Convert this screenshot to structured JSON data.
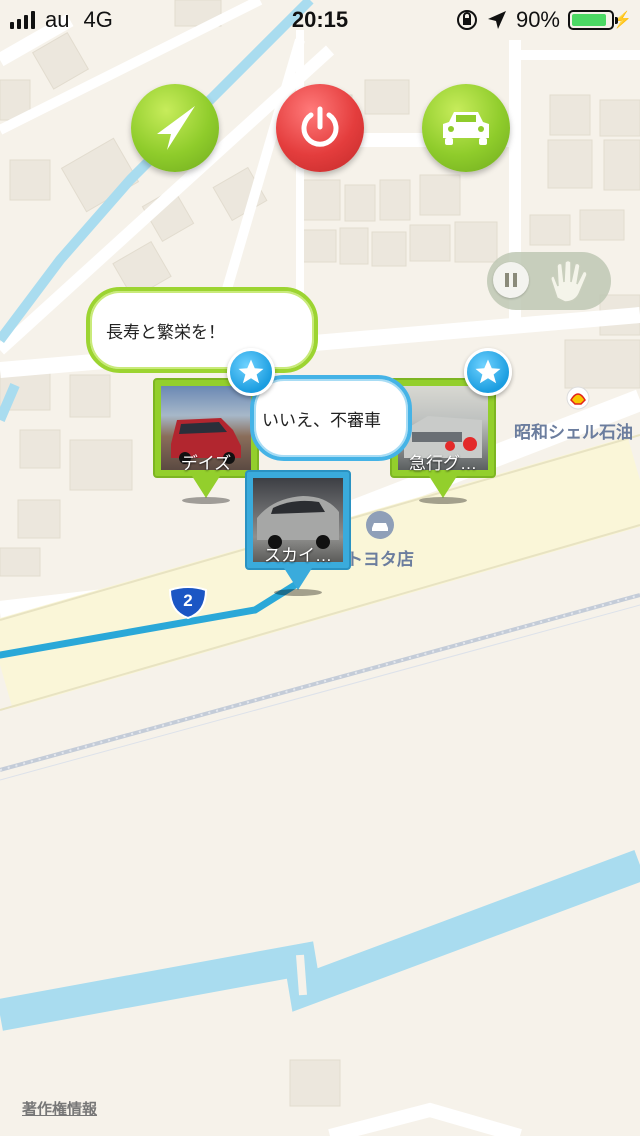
{
  "status_bar": {
    "carrier": "au",
    "network": "4G",
    "time": "20:15",
    "battery_percent": "90%",
    "battery_level": 0.9
  },
  "controls": {
    "navigate_icon": "navigation-arrow-icon",
    "power_icon": "power-icon",
    "car_icon": "car-icon",
    "pause_icon": "pause-icon",
    "hand_icon": "hand-icon"
  },
  "colors": {
    "accent_green": "#8fcc2b",
    "accent_red": "#e43d3d",
    "accent_blue": "#3aabdc",
    "route": "#2aa8d8",
    "water": "#a9dcef"
  },
  "bubbles": [
    {
      "text": "長寿と繁栄を！"
    },
    {
      "text": "いいえ、不審車"
    }
  ],
  "pins": [
    {
      "label": "デイズ",
      "starred": true
    },
    {
      "label": "スカイ…",
      "starred": false
    },
    {
      "label": "急行グ…",
      "starred": true
    }
  ],
  "pois": [
    {
      "label": "昭和シェル石油",
      "icon": "shell-icon"
    },
    {
      "label": "トヨタ店",
      "icon": "car-dealer-icon"
    }
  ],
  "route_marker": {
    "label": "2"
  },
  "footer": {
    "copyright": "著作権情報"
  }
}
